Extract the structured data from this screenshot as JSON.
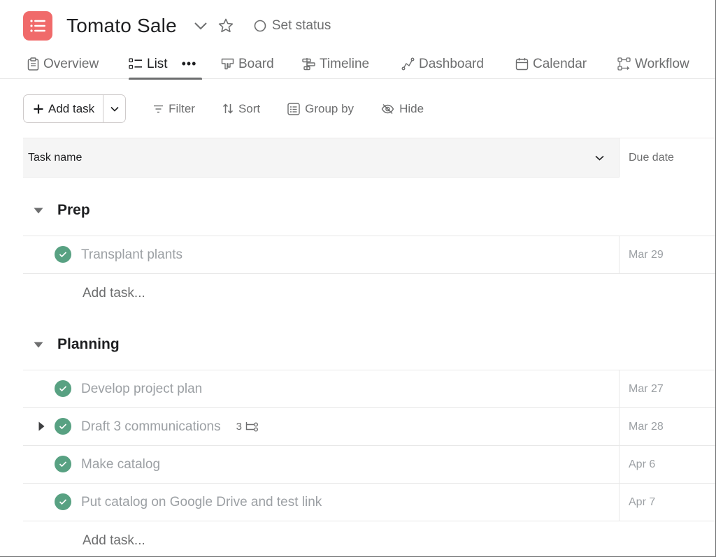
{
  "project": {
    "title": "Tomato Sale",
    "icon": "list-icon",
    "icon_color": "#f06a6a",
    "set_status_label": "Set status"
  },
  "tabs": [
    {
      "label": "Overview",
      "icon": "clipboard-icon",
      "active": false
    },
    {
      "label": "List",
      "icon": "list-bullets-icon",
      "active": true,
      "more": "•••"
    },
    {
      "label": "Board",
      "icon": "board-icon",
      "active": false
    },
    {
      "label": "Timeline",
      "icon": "timeline-icon",
      "active": false
    },
    {
      "label": "Dashboard",
      "icon": "dashboard-icon",
      "active": false
    },
    {
      "label": "Calendar",
      "icon": "calendar-icon",
      "active": false
    },
    {
      "label": "Workflow",
      "icon": "workflow-icon",
      "active": false
    }
  ],
  "toolbar": {
    "add_task_label": "Add task",
    "filter_label": "Filter",
    "sort_label": "Sort",
    "group_by_label": "Group by",
    "hide_label": "Hide"
  },
  "table": {
    "columns": {
      "task_name": "Task name",
      "due_date": "Due date"
    }
  },
  "sections": [
    {
      "title": "Prep",
      "tasks": [
        {
          "name": "Transplant plants",
          "due": "Mar 29",
          "completed": true
        }
      ],
      "add_task_label": "Add task..."
    },
    {
      "title": "Planning",
      "tasks": [
        {
          "name": "Develop project plan",
          "due": "Mar 27",
          "completed": true
        },
        {
          "name": "Draft 3 communications",
          "due": "Mar 28",
          "completed": true,
          "subtask_count": "3"
        },
        {
          "name": "Make catalog",
          "due": "Apr 6",
          "completed": true
        },
        {
          "name": "Put catalog on Google Drive and test link",
          "due": "Apr 7",
          "completed": true
        }
      ],
      "add_task_label": "Add task..."
    }
  ],
  "colors": {
    "completed_check": "#58a182",
    "accent_text": "#1e1f21",
    "muted_text": "#6d6e6f",
    "completed_text": "#9ca0a4"
  }
}
